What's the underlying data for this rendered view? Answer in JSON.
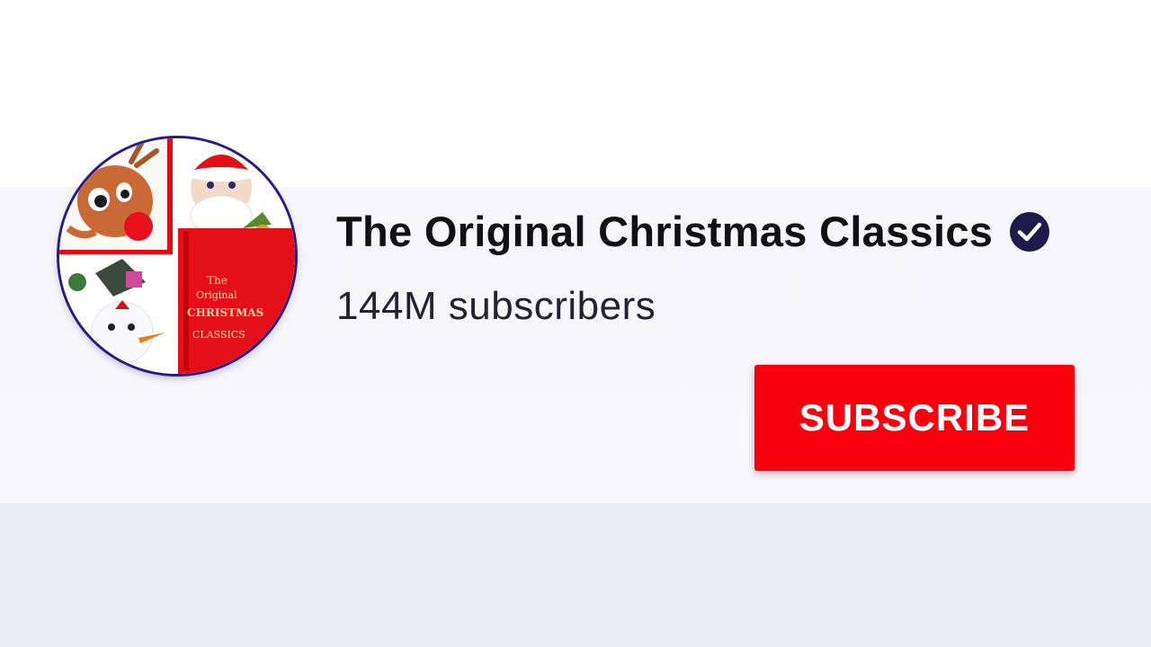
{
  "channel": {
    "name": "The Original Christmas Classics",
    "subscribers": "144M subscribers",
    "verified": true,
    "avatar_icon": "christmas-classics-avatar",
    "avatar_text": [
      "The",
      "Original",
      "CHRISTMAS",
      "CLASSICS"
    ]
  },
  "actions": {
    "subscribe_label": "SUBSCRIBE"
  },
  "colors": {
    "subscribe_bg": "#f8000d",
    "verified_badge": "#1e1b4b",
    "avatar_ring": "#2a1a86"
  }
}
